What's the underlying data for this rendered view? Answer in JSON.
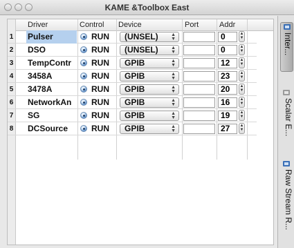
{
  "window": {
    "title": "KAME &Toolbox East"
  },
  "table": {
    "headers": [
      "Driver",
      "Control",
      "Device",
      "Port",
      "Addr"
    ],
    "rows": [
      {
        "num": "1",
        "driver": "Pulser",
        "control": "RUN",
        "device": "(UNSEL)",
        "port": "",
        "addr": "0",
        "selected": true
      },
      {
        "num": "2",
        "driver": "DSO",
        "control": "RUN",
        "device": "(UNSEL)",
        "port": "",
        "addr": "0"
      },
      {
        "num": "3",
        "driver": "TempContr",
        "control": "RUN",
        "device": "GPIB",
        "port": "",
        "addr": "12"
      },
      {
        "num": "4",
        "driver": "3458A",
        "control": "RUN",
        "device": "GPIB",
        "port": "",
        "addr": "23"
      },
      {
        "num": "5",
        "driver": "3478A",
        "control": "RUN",
        "device": "GPIB",
        "port": "",
        "addr": "20"
      },
      {
        "num": "6",
        "driver": "NetworkAn",
        "control": "RUN",
        "device": "GPIB",
        "port": "",
        "addr": "16"
      },
      {
        "num": "7",
        "driver": "SG",
        "control": "RUN",
        "device": "GPIB",
        "port": "",
        "addr": "19"
      },
      {
        "num": "8",
        "driver": "DCSource",
        "control": "RUN",
        "device": "GPIB",
        "port": "",
        "addr": "27"
      }
    ]
  },
  "sidebar": {
    "tabs": [
      {
        "label": "Inter...",
        "icon": "interface-icon",
        "active": true
      },
      {
        "label": "Scalar E...",
        "icon": "scalar-icon",
        "active": false
      },
      {
        "label": "Raw Stream R...",
        "icon": "raw-stream-icon",
        "active": false
      }
    ]
  }
}
